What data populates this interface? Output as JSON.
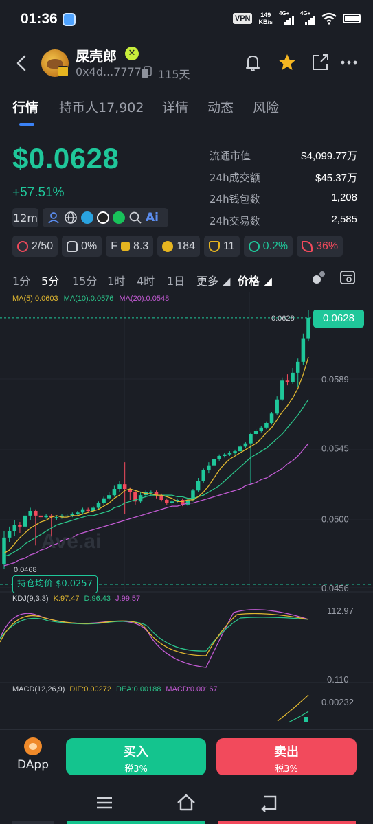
{
  "status_bar": {
    "time": "01:36",
    "vpn": "VPN",
    "net_speed_value": "149",
    "net_speed_unit": "KB/s",
    "sim1": "4G+",
    "sim2": "4G+"
  },
  "header": {
    "token_name": "屎壳郎",
    "address": "0x4d...7777",
    "age": "115天",
    "icons": [
      "back-icon",
      "bell-icon",
      "star-icon",
      "share-icon",
      "more-icon"
    ]
  },
  "tabs": [
    {
      "label": "行情",
      "active": true
    },
    {
      "label": "持币人17,902",
      "active": false
    },
    {
      "label": "详情",
      "active": false
    },
    {
      "label": "动态",
      "active": false
    },
    {
      "label": "风险",
      "active": false
    }
  ],
  "price": {
    "value": "$0.0628",
    "change": "+57.51%",
    "color_up": "#1fc79a"
  },
  "stats": [
    {
      "label": "流通市值",
      "value": "$4,099.77万"
    },
    {
      "label": "24h成交额",
      "value": "$45.37万"
    },
    {
      "label": "24h钱包数",
      "value": "1,208"
    },
    {
      "label": "24h交易数",
      "value": "2,585"
    }
  ],
  "token_age_chip": "12m",
  "socials": [
    "user-icon",
    "globe-icon",
    "telegram-icon",
    "qq-icon",
    "wechat-icon",
    "search-icon",
    "ai-icon"
  ],
  "ai_label": "Ai",
  "metrics": [
    {
      "icon": "holders-icon",
      "value": "2/50"
    },
    {
      "icon": "chef-icon",
      "value": "0%"
    },
    {
      "icon": "f-score-icon",
      "prefix": "F",
      "value": "8.3"
    },
    {
      "icon": "money-bag-icon",
      "value": "184"
    },
    {
      "icon": "trophy-icon",
      "value": "11"
    },
    {
      "icon": "smile-icon",
      "value": "0.2%"
    },
    {
      "icon": "rocket-icon",
      "value": "36%"
    }
  ],
  "intervals": [
    {
      "label": "1分",
      "active": false
    },
    {
      "label": "5分",
      "active": true
    },
    {
      "label": "15分",
      "active": false
    },
    {
      "label": "1时",
      "active": false
    },
    {
      "label": "4时",
      "active": false
    },
    {
      "label": "1日",
      "active": false
    }
  ],
  "more_label": "更多",
  "price_type_label": "价格",
  "ma_legend": [
    {
      "label": "MA(5):0.0603",
      "color": "#e0b730"
    },
    {
      "label": "MA(10):0.0576",
      "color": "#2bc48a"
    },
    {
      "label": "MA(20):0.0548",
      "color": "#c35bd4"
    }
  ],
  "chart_data": {
    "type": "candlestick",
    "interval": "5分",
    "y_axis_labels": [
      "0.0589",
      "0.0545",
      "0.0500",
      "0.0456"
    ],
    "ylim": [
      0.0456,
      0.0633
    ],
    "last_price_label": "0.0628",
    "last_price_tag": "0.0628",
    "low_label": "0.0468",
    "hold_avg_label": "持仓均价 $0.0257",
    "candles": [
      [
        0.0471,
        0.0488,
        0.0468,
        0.0492
      ],
      [
        0.0488,
        0.0492,
        0.0485,
        0.0495
      ],
      [
        0.0492,
        0.0496,
        0.0489,
        0.0499
      ],
      [
        0.0496,
        0.0495,
        0.0491,
        0.0498
      ],
      [
        0.0495,
        0.0502,
        0.0493,
        0.0504
      ],
      [
        0.0502,
        0.0505,
        0.0499,
        0.0507
      ],
      [
        0.0505,
        0.0502,
        0.0483,
        0.0506
      ],
      [
        0.0502,
        0.0501,
        0.0499,
        0.0503
      ],
      [
        0.0501,
        0.0502,
        0.05,
        0.0503
      ],
      [
        0.0502,
        0.0501,
        0.0488,
        0.0503
      ],
      [
        0.0501,
        0.0501,
        0.0499,
        0.0502
      ],
      [
        0.0501,
        0.0502,
        0.05,
        0.0503
      ],
      [
        0.0502,
        0.0502,
        0.0501,
        0.0503
      ],
      [
        0.0502,
        0.0503,
        0.0501,
        0.0504
      ],
      [
        0.0503,
        0.0504,
        0.0502,
        0.0505
      ],
      [
        0.0504,
        0.0506,
        0.0503,
        0.0507
      ],
      [
        0.0506,
        0.0505,
        0.0504,
        0.0507
      ],
      [
        0.0505,
        0.0507,
        0.0504,
        0.0508
      ],
      [
        0.0507,
        0.051,
        0.0506,
        0.0511
      ],
      [
        0.051,
        0.0513,
        0.0509,
        0.0514
      ],
      [
        0.0513,
        0.0515,
        0.0512,
        0.0517
      ],
      [
        0.0515,
        0.0519,
        0.0514,
        0.0521
      ],
      [
        0.0519,
        0.0522,
        0.0517,
        0.0524
      ],
      [
        0.0522,
        0.0519,
        0.0503,
        0.0536
      ],
      [
        0.0519,
        0.0517,
        0.0512,
        0.052
      ],
      [
        0.0517,
        0.0511,
        0.0509,
        0.0518
      ],
      [
        0.0511,
        0.0515,
        0.051,
        0.0517
      ],
      [
        0.0515,
        0.0517,
        0.0514,
        0.0518
      ],
      [
        0.0517,
        0.0517,
        0.0515,
        0.0518
      ],
      [
        0.0517,
        0.0515,
        0.0513,
        0.0518
      ],
      [
        0.0515,
        0.0512,
        0.0511,
        0.0516
      ],
      [
        0.0512,
        0.051,
        0.0509,
        0.0513
      ],
      [
        0.051,
        0.0511,
        0.0509,
        0.0512
      ],
      [
        0.0511,
        0.0512,
        0.051,
        0.0513
      ],
      [
        0.0512,
        0.0509,
        0.0508,
        0.0513
      ],
      [
        0.0509,
        0.0512,
        0.0508,
        0.0513
      ],
      [
        0.0512,
        0.0518,
        0.0511,
        0.0519
      ],
      [
        0.0518,
        0.0524,
        0.0517,
        0.0526
      ],
      [
        0.0524,
        0.0531,
        0.0523,
        0.0532
      ],
      [
        0.0531,
        0.0534,
        0.0529,
        0.0536
      ],
      [
        0.0534,
        0.0538,
        0.0533,
        0.054
      ],
      [
        0.0538,
        0.054,
        0.0537,
        0.0541
      ],
      [
        0.054,
        0.0541,
        0.0539,
        0.0542
      ],
      [
        0.0541,
        0.0542,
        0.054,
        0.0543
      ],
      [
        0.0542,
        0.0543,
        0.0541,
        0.0544
      ],
      [
        0.0543,
        0.0546,
        0.0542,
        0.0547
      ],
      [
        0.0546,
        0.0548,
        0.0545,
        0.0549
      ],
      [
        0.0548,
        0.0554,
        0.0522,
        0.0555
      ],
      [
        0.0554,
        0.0556,
        0.0553,
        0.0557
      ],
      [
        0.0556,
        0.0558,
        0.0555,
        0.0559
      ],
      [
        0.0558,
        0.0561,
        0.0557,
        0.0562
      ],
      [
        0.0561,
        0.0567,
        0.056,
        0.0568
      ],
      [
        0.0567,
        0.0576,
        0.0566,
        0.0578
      ],
      [
        0.0576,
        0.0588,
        0.0575,
        0.059
      ],
      [
        0.0588,
        0.0587,
        0.0585,
        0.0592
      ],
      [
        0.0587,
        0.0593,
        0.0586,
        0.0596
      ],
      [
        0.0593,
        0.06,
        0.0584,
        0.0602
      ],
      [
        0.06,
        0.0615,
        0.0598,
        0.0618
      ],
      [
        0.0615,
        0.0628,
        0.0613,
        0.0633
      ]
    ],
    "ma5_values": [
      0.0478,
      0.048,
      0.0484,
      0.0488,
      0.0491,
      0.0494,
      0.0496,
      0.0498,
      0.0499,
      0.0501,
      0.0502,
      0.0501,
      0.0501,
      0.0502,
      0.0502,
      0.0503,
      0.0504,
      0.0505,
      0.0506,
      0.0508,
      0.051,
      0.0513,
      0.0515,
      0.0518,
      0.0519,
      0.0518,
      0.0517,
      0.0516,
      0.0516,
      0.0515,
      0.0515,
      0.0514,
      0.0513,
      0.0511,
      0.0511,
      0.0512,
      0.0512,
      0.0514,
      0.0517,
      0.0521,
      0.0526,
      0.0531,
      0.0535,
      0.0538,
      0.054,
      0.0542,
      0.0544,
      0.0546,
      0.0548,
      0.0551,
      0.0555,
      0.0558,
      0.0563,
      0.0568,
      0.0572,
      0.0577,
      0.0583,
      0.0592,
      0.0603
    ],
    "ma10_values": [
      0.0476,
      0.0477,
      0.0479,
      0.0481,
      0.0484,
      0.0486,
      0.0488,
      0.049,
      0.0492,
      0.0494,
      0.0496,
      0.0497,
      0.0498,
      0.0499,
      0.05,
      0.0501,
      0.0502,
      0.0502,
      0.0503,
      0.0504,
      0.0505,
      0.0507,
      0.0508,
      0.051,
      0.0511,
      0.0512,
      0.0513,
      0.0514,
      0.0515,
      0.0515,
      0.0515,
      0.0515,
      0.0515,
      0.0514,
      0.0514,
      0.0513,
      0.0513,
      0.0514,
      0.0515,
      0.0517,
      0.0519,
      0.0521,
      0.0524,
      0.0527,
      0.053,
      0.0533,
      0.0536,
      0.0539,
      0.0541,
      0.0543,
      0.0545,
      0.0548,
      0.0551,
      0.0554,
      0.0558,
      0.0562,
      0.0566,
      0.0571,
      0.0576
    ],
    "ma20_values": [
      0.047,
      0.0471,
      0.0472,
      0.0474,
      0.0475,
      0.0477,
      0.0478,
      0.048,
      0.0481,
      0.0483,
      0.0484,
      0.0486,
      0.0487,
      0.0488,
      0.049,
      0.0491,
      0.0492,
      0.0493,
      0.0494,
      0.0495,
      0.0496,
      0.0497,
      0.0498,
      0.0499,
      0.05,
      0.0501,
      0.0502,
      0.0503,
      0.0504,
      0.0505,
      0.0506,
      0.0507,
      0.0508,
      0.0508,
      0.0509,
      0.051,
      0.051,
      0.0511,
      0.0512,
      0.0513,
      0.0514,
      0.0515,
      0.0516,
      0.0517,
      0.0518,
      0.0519,
      0.0521,
      0.0522,
      0.0523,
      0.0525,
      0.0526,
      0.0528,
      0.053,
      0.0532,
      0.0535,
      0.0537,
      0.054,
      0.0544,
      0.0548
    ],
    "kdj": {
      "legend": [
        {
          "label": "KDJ(9,3,3)",
          "color": "#cfd2d8"
        },
        {
          "label": "K:97.47",
          "color": "#e0b730"
        },
        {
          "label": "D:96.43",
          "color": "#2bc48a"
        },
        {
          "label": "J:99.57",
          "color": "#c35bd4"
        }
      ],
      "axis_labels": [
        "112.97",
        "0.110"
      ]
    },
    "macd": {
      "legend": [
        {
          "label": "MACD(12,26,9)",
          "color": "#cfd2d8"
        },
        {
          "label": "DIF:0.00272",
          "color": "#e0b730"
        },
        {
          "label": "DEA:0.00188",
          "color": "#2bc48a"
        },
        {
          "label": "MACD:0.00167",
          "color": "#c35bd4"
        }
      ],
      "axis_label": "0.00232"
    }
  },
  "watermark": "Ave.ai",
  "actions": {
    "dapp_label": "DApp",
    "buy_label": "买入",
    "buy_tax": "税3%",
    "sell_label": "卖出",
    "sell_tax": "税3%",
    "buy_color": "#14c48e",
    "sell_color": "#f24a5c"
  },
  "system_nav": [
    "menu-icon",
    "home-icon",
    "back-nav-icon"
  ]
}
